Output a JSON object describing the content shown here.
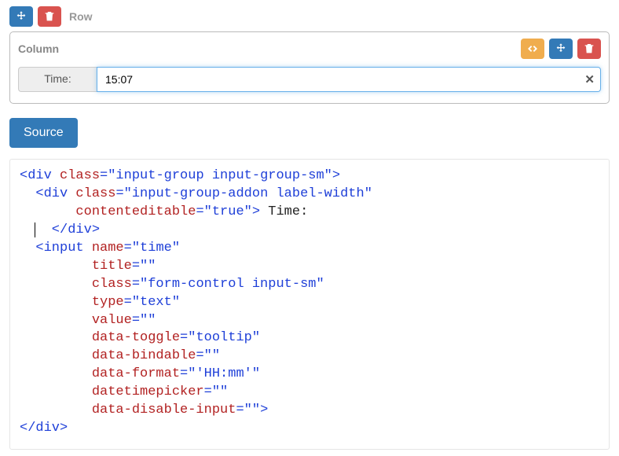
{
  "row": {
    "label": "Row"
  },
  "column": {
    "label": "Column"
  },
  "form": {
    "time_label": " Time:",
    "time_value": "15:07"
  },
  "buttons": {
    "source": "Source"
  },
  "code": {
    "l1_open": "<div ",
    "l1_a1": "class",
    "l1_v1": "\"input-group input-group-sm\"",
    "l1_close": ">",
    "l2_open": "  <div ",
    "l2_a1": "class",
    "l2_v1": "\"input-group-addon label-width\"",
    "l3_a1": "       contenteditable",
    "l3_v1": "\"true\"",
    "l3_close": ">",
    "l3_text": " Time:",
    "l4": "  </div>",
    "l5_open": "  <input ",
    "l5_a1": "name",
    "l5_v1": "\"time\"",
    "l6_a1": "         title",
    "l6_v1": "\"\"",
    "l7_a1": "         class",
    "l7_v1": "\"form-control input-sm\"",
    "l8_a1": "         type",
    "l8_v1": "\"text\"",
    "l9_a1": "         value",
    "l9_v1": "\"\"",
    "l10_a1": "         data-toggle",
    "l10_v1": "\"tooltip\"",
    "l11_a1": "         data-bindable",
    "l11_v1": "\"\"",
    "l12_a1": "         data-format",
    "l12_v1": "\"'HH:mm'\"",
    "l13_a1": "         datetimepicker",
    "l13_v1": "\"\"",
    "l14_a1": "         data-disable-input",
    "l14_v1": "\"\"",
    "l14_close": ">",
    "l15": "</div>"
  }
}
